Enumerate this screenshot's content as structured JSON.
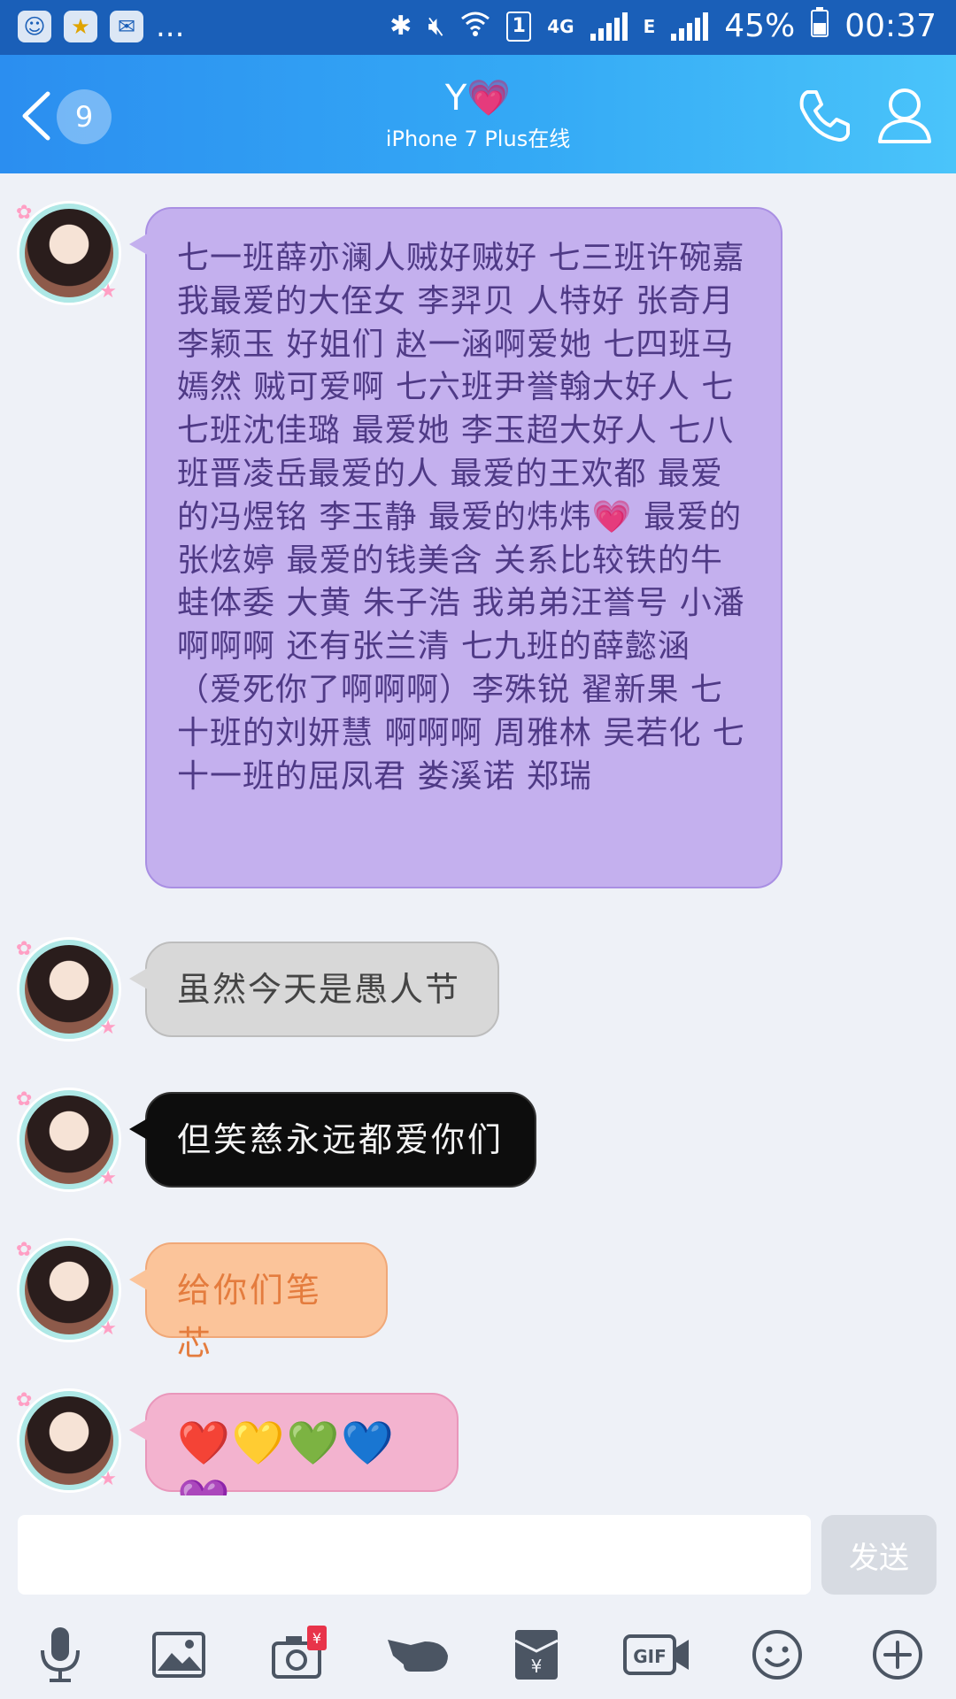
{
  "status_bar": {
    "battery": "45%",
    "time": "00:37",
    "sim_slot": "1",
    "network_4g": "4G",
    "network_e": "E",
    "more": "..."
  },
  "header": {
    "back_badge": "9",
    "contact_name": "Y",
    "contact_heart": "💗",
    "status": "iPhone 7 Plus在线"
  },
  "messages": [
    {
      "text": "七一班薛亦澜人贼好贼好 七三班许碗嘉 我最爱的大侄女 李羿贝 人特好 张奇月 李颖玉 好姐们 赵一涵啊爱她 七四班马嫣然 贼可爱啊 七六班尹誉翰大好人 七七班沈佳璐 最爱她 李玉超大好人 七八班晋凌岳最爱的人 最爱的王欢都 最爱的冯煜铭 李玉静 最爱的炜炜💗 最爱的张炫婷 最爱的钱美含 关系比较铁的牛蛙体委 大黄 朱子浩 我弟弟汪誉号 小潘啊啊啊 还有张兰清 七九班的薛懿涵（爱死你了啊啊啊）李殊锐 翟新果 七十班的刘妍慧 啊啊啊 周雅林 吴若化 七十一班的屈凤君 娄溪诺 郑瑞"
    },
    {
      "text": "虽然今天是愚人节"
    },
    {
      "text": "但笑慈永远都爱你们"
    },
    {
      "text": "给你们笔芯"
    },
    {
      "text": "❤️💛💚💙💜"
    }
  ],
  "input": {
    "value": "",
    "send_label": "发送"
  },
  "toolbar": {
    "gif_label": "GIF",
    "redpacket_label": "¥"
  },
  "colors": {
    "header_start": "#2b8ef0",
    "header_end": "#4ac4fa",
    "purple_bubble": "#c4b0ee",
    "grey_bubble": "#d8d8d8",
    "black_bubble": "#0d0d0d",
    "orange_bubble": "#fbc49a",
    "pink_bubble": "#f3b3cf"
  },
  "icons": [
    "mic-icon",
    "image-icon",
    "camera-icon",
    "poke-icon",
    "redpacket-icon",
    "gif-icon",
    "emoji-icon",
    "plus-icon"
  ]
}
